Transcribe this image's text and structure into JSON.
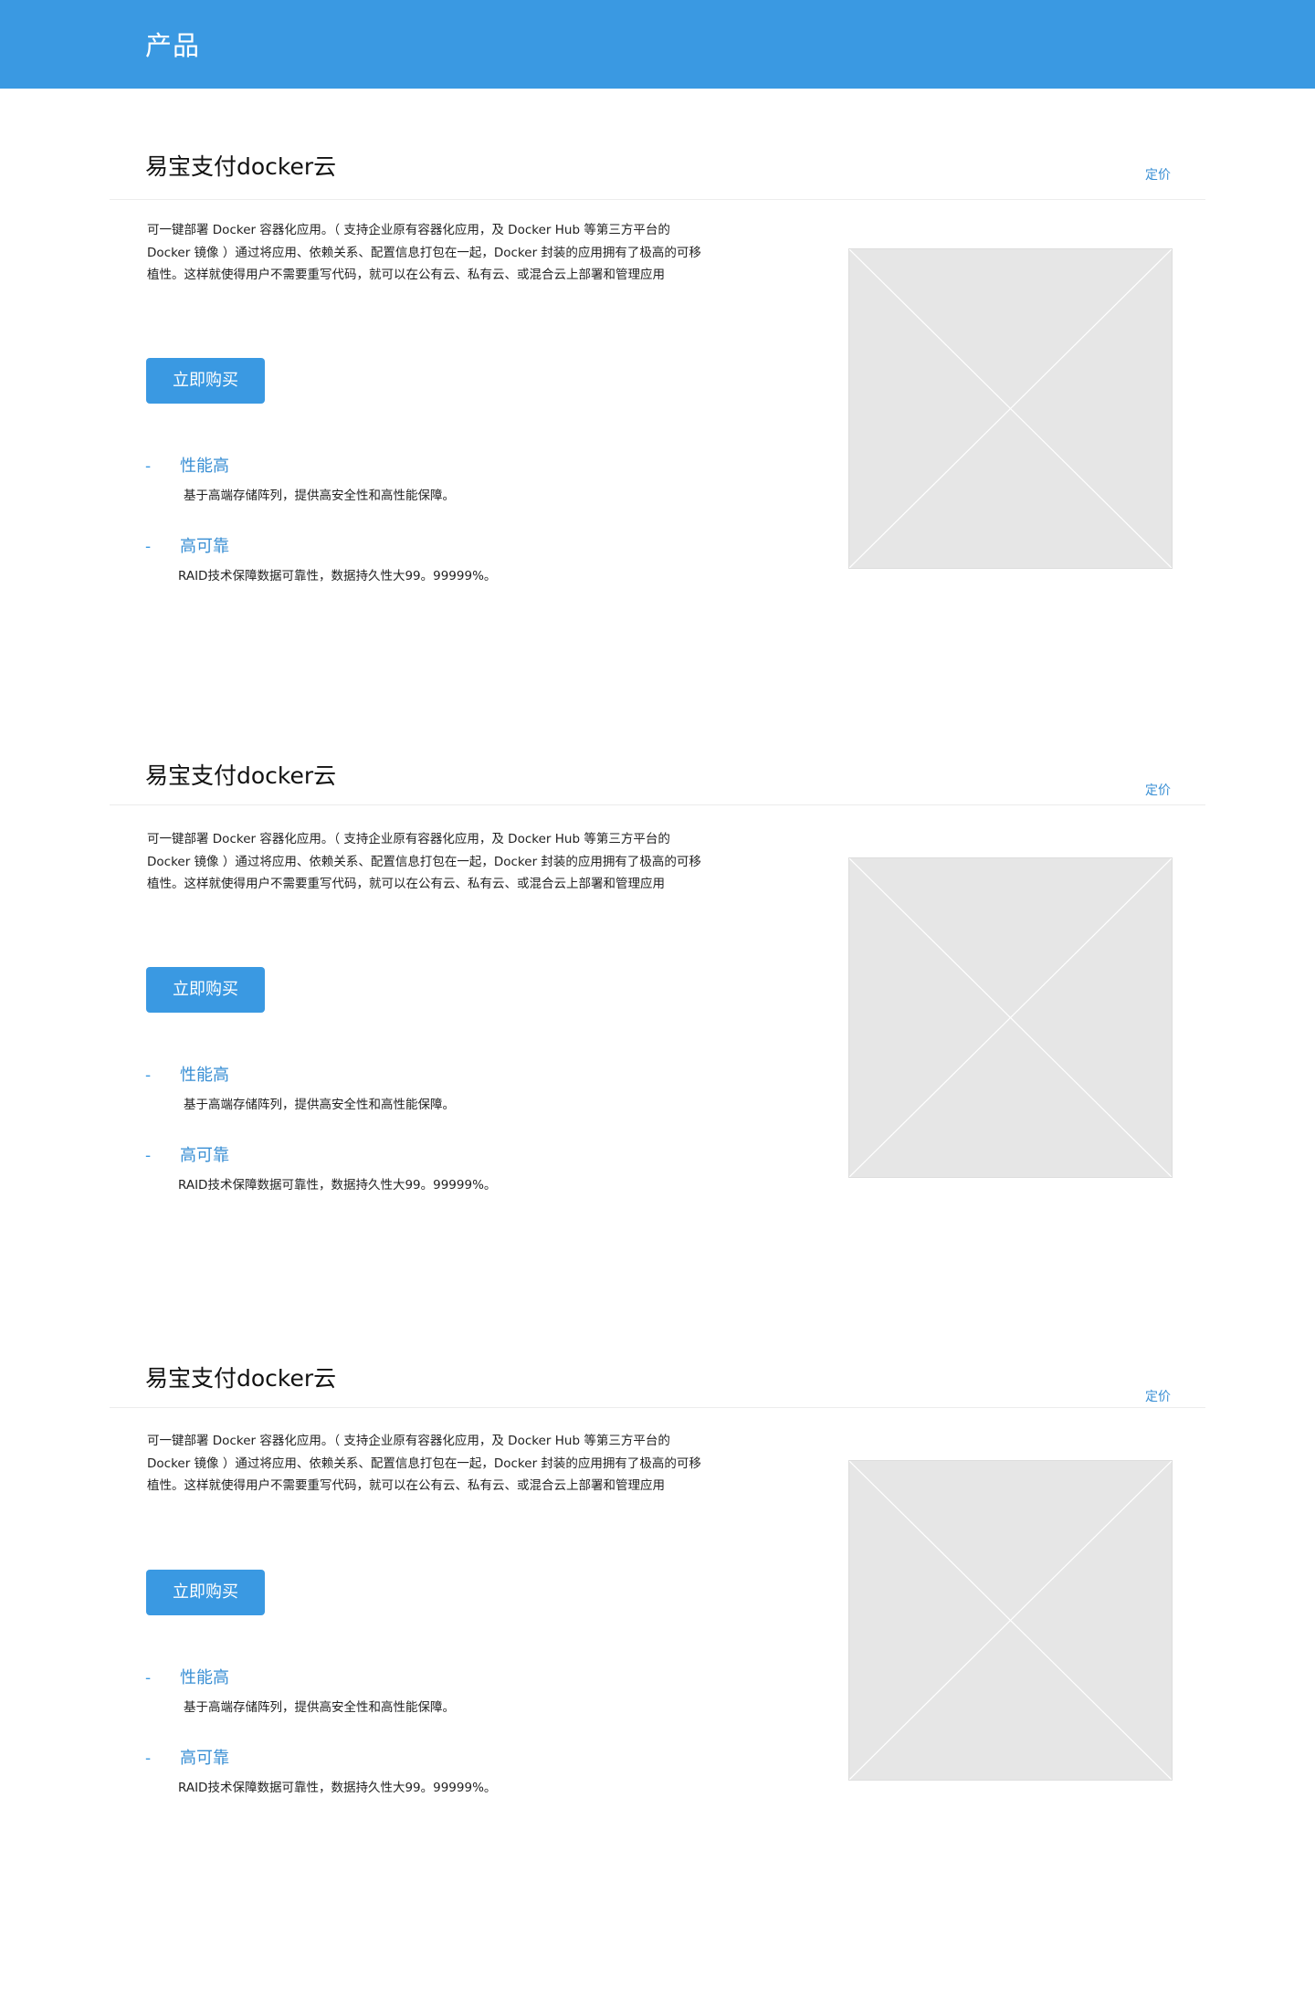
{
  "header": {
    "title": "产品"
  },
  "sections": [
    {
      "title": "易宝支付docker云",
      "pricing_link": "定价",
      "description": "可一键部署 Docker 容器化应用。（ 支持企业原有容器化应用，及 Docker Hub 等第三方平台的 Docker 镜像 ）通过将应用、依赖关系、配置信息打包在一起，Docker 封装的应用拥有了极高的可移植性。这样就使得用户不需要重写代码，就可以在公有云、私有云、或混合云上部署和管理应用",
      "buy_button": "立即购买",
      "features": [
        {
          "dash": "-",
          "title": "性能高",
          "description": "基于高端存储阵列，提供高安全性和高性能保障。"
        },
        {
          "dash": "-",
          "title": "高可靠",
          "description": "RAID技术保障数据可靠性，数据持久性大99。99999%。"
        }
      ]
    },
    {
      "title": "易宝支付docker云",
      "pricing_link": "定价",
      "description": "可一键部署 Docker 容器化应用。（ 支持企业原有容器化应用，及 Docker Hub 等第三方平台的 Docker 镜像 ）通过将应用、依赖关系、配置信息打包在一起，Docker 封装的应用拥有了极高的可移植性。这样就使得用户不需要重写代码，就可以在公有云、私有云、或混合云上部署和管理应用",
      "buy_button": "立即购买",
      "features": [
        {
          "dash": "-",
          "title": "性能高",
          "description": "基于高端存储阵列，提供高安全性和高性能保障。"
        },
        {
          "dash": "-",
          "title": "高可靠",
          "description": "RAID技术保障数据可靠性，数据持久性大99。99999%。"
        }
      ]
    },
    {
      "title": "易宝支付docker云",
      "pricing_link": "定价",
      "description": "可一键部署 Docker 容器化应用。（ 支持企业原有容器化应用，及 Docker Hub 等第三方平台的 Docker 镜像 ）通过将应用、依赖关系、配置信息打包在一起，Docker 封装的应用拥有了极高的可移植性。这样就使得用户不需要重写代码，就可以在公有云、私有云、或混合云上部署和管理应用",
      "buy_button": "立即购买",
      "features": [
        {
          "dash": "-",
          "title": "性能高",
          "description": "基于高端存储阵列，提供高安全性和高性能保障。"
        },
        {
          "dash": "-",
          "title": "高可靠",
          "description": "RAID技术保障数据可靠性，数据持久性大99。99999%。"
        }
      ]
    }
  ],
  "colors": {
    "accent": "#3a99e2",
    "link": "#3a8fd4",
    "placeholder_bg": "#e6e6e6",
    "divider": "#ececec"
  },
  "icons": {
    "image_placeholder": "image-placeholder-icon"
  }
}
